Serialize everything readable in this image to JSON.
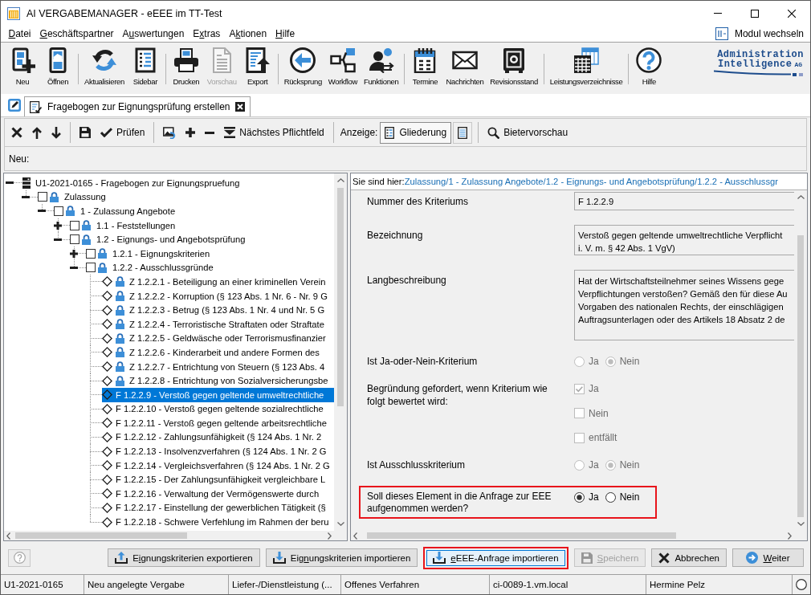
{
  "window": {
    "title": "AI VERGABEMANAGER - eEEE im TT-Test"
  },
  "menu": {
    "items": [
      {
        "access_key": "D",
        "text_after": "atei"
      },
      {
        "access_key": "G",
        "text_after": "eschäftspartner"
      },
      {
        "text_before": "A",
        "access_key": "u",
        "text_after": "swertungen"
      },
      {
        "text_before": "E",
        "access_key": "x",
        "text_after": "tras"
      },
      {
        "text_before": "A",
        "access_key": "k",
        "text_after": "tionen"
      },
      {
        "access_key": "H",
        "text_after": "ilfe"
      }
    ],
    "module_switch": "Modul wechseln"
  },
  "toolbar": {
    "groups": [
      [
        {
          "label": "Neu",
          "disabled": false
        },
        {
          "label": "Öffnen",
          "disabled": false
        }
      ],
      [
        {
          "label": "Aktualisieren",
          "disabled": false
        },
        {
          "label": "Sidebar",
          "disabled": false
        }
      ],
      [
        {
          "label": "Drucken",
          "disabled": false
        },
        {
          "label": "Vorschau",
          "disabled": true
        },
        {
          "label": "Export",
          "disabled": false
        }
      ],
      [
        {
          "label": "Rücksprung",
          "disabled": false
        },
        {
          "label": "Workflow",
          "disabled": false
        },
        {
          "label": "Funktionen",
          "disabled": false
        }
      ],
      [
        {
          "label": "Termine",
          "disabled": false
        },
        {
          "label": "Nachrichten",
          "disabled": false
        },
        {
          "label": "Revisionsstand",
          "disabled": false
        }
      ],
      [
        {
          "label": "Leistungsverzeichnisse",
          "disabled": false
        }
      ],
      [
        {
          "label": "Hilfe",
          "disabled": false
        }
      ]
    ],
    "logo": {
      "lines": [
        "Administration",
        "Intelligence"
      ],
      "suffix": "AG"
    }
  },
  "tabs": [
    {
      "label": "Fragebogen zur Eignungsprüfung erstellen",
      "selected": true
    }
  ],
  "editor_toolbar": {
    "groups": [
      [
        {
          "kind": "button"
        },
        {
          "kind": "button"
        },
        {
          "kind": "button"
        }
      ],
      [
        {
          "kind": "button"
        },
        {
          "kind": "button",
          "label": "Prüfen"
        }
      ],
      [
        {
          "kind": "button"
        },
        {
          "kind": "button"
        },
        {
          "kind": "button"
        },
        {
          "kind": "button",
          "label": "Nächstes Pflichtfeld"
        }
      ],
      [
        {
          "kind": "caption",
          "label": "Anzeige:"
        },
        {
          "kind": "toggle",
          "label": "Gliederung",
          "selected": true
        },
        {
          "kind": "toggle",
          "selected": false
        }
      ],
      [
        {
          "kind": "button",
          "label": "Bietervorschau"
        }
      ]
    ]
  },
  "info_bar": {
    "label": "Neu:"
  },
  "tree": [
    {
      "kind": "root",
      "label": "U1-2021-0165 - Fragebogen zur Eignungspruefung",
      "expanded": true,
      "selected": false,
      "children": [
        {
          "kind": "group",
          "label": "Zulassung",
          "checked": false,
          "locked": true,
          "expanded": true,
          "selected": false,
          "children": [
            {
              "kind": "group",
              "label": "1 - Zulassung Angebote",
              "checked": false,
              "locked": true,
              "expanded": true,
              "selected": false,
              "children": [
                {
                  "kind": "group",
                  "label": "1.1 - Feststellungen",
                  "checked": false,
                  "locked": true,
                  "expanded": false,
                  "selected": false
                },
                {
                  "kind": "group",
                  "label": "1.2 - Eignungs- und Angebotsprüfung",
                  "checked": false,
                  "locked": true,
                  "expanded": true,
                  "selected": false,
                  "children": [
                    {
                      "kind": "group",
                      "label": "1.2.1 - Eignungskriterien",
                      "checked": false,
                      "locked": true,
                      "expanded": false,
                      "selected": false
                    },
                    {
                      "kind": "group",
                      "label": "1.2.2 - Ausschlussgründe",
                      "checked": false,
                      "locked": true,
                      "expanded": true,
                      "selected": false,
                      "children": [
                        {
                          "kind": "criterion",
                          "label": "Z 1.2.2.1 - Beteiligung an einer kriminellen Verein",
                          "locked": true,
                          "selected": false
                        },
                        {
                          "kind": "criterion",
                          "label": "Z 1.2.2.2 - Korruption (§ 123 Abs. 1 Nr. 6 - Nr. 9 G",
                          "locked": true,
                          "selected": false
                        },
                        {
                          "kind": "criterion",
                          "label": "Z 1.2.2.3 - Betrug (§ 123 Abs. 1 Nr. 4 und Nr. 5 G",
                          "locked": true,
                          "selected": false
                        },
                        {
                          "kind": "criterion",
                          "label": "Z 1.2.2.4 - Terroristische Straftaten oder Straftate",
                          "locked": true,
                          "selected": false
                        },
                        {
                          "kind": "criterion",
                          "label": "Z 1.2.2.5 - Geldwäsche oder Terrorismusfinanzier",
                          "locked": true,
                          "selected": false
                        },
                        {
                          "kind": "criterion",
                          "label": "Z 1.2.2.6 - Kinderarbeit und andere Formen des",
                          "locked": true,
                          "selected": false
                        },
                        {
                          "kind": "criterion",
                          "label": "Z 1.2.2.7 - Entrichtung von Steuern (§ 123 Abs. 4",
                          "locked": true,
                          "selected": false
                        },
                        {
                          "kind": "criterion",
                          "label": "Z 1.2.2.8 - Entrichtung von Sozialversicherungsbe",
                          "locked": true,
                          "selected": false
                        },
                        {
                          "kind": "criterion",
                          "label": "F 1.2.2.9 - Verstoß gegen geltende umweltrechtliche",
                          "locked": false,
                          "selected": true
                        },
                        {
                          "kind": "criterion",
                          "label": "F 1.2.2.10 - Verstoß gegen geltende sozialrechtliche",
                          "locked": false,
                          "selected": false
                        },
                        {
                          "kind": "criterion",
                          "label": "F 1.2.2.11 - Verstoß gegen geltende arbeitsrechtliche",
                          "locked": false,
                          "selected": false
                        },
                        {
                          "kind": "criterion",
                          "label": "F 1.2.2.12 - Zahlungsunfähigkeit (§ 124 Abs. 1 Nr. 2",
                          "locked": false,
                          "selected": false
                        },
                        {
                          "kind": "criterion",
                          "label": "F 1.2.2.13 - Insolvenzverfahren (§ 124 Abs. 1 Nr. 2 G",
                          "locked": false,
                          "selected": false
                        },
                        {
                          "kind": "criterion",
                          "label": "F 1.2.2.14 - Vergleichsverfahren (§ 124 Abs. 1 Nr. 2 G",
                          "locked": false,
                          "selected": false
                        },
                        {
                          "kind": "criterion",
                          "label": "F 1.2.2.15 - Der Zahlungsunfähigkeit vergleichbare L",
                          "locked": false,
                          "selected": false
                        },
                        {
                          "kind": "criterion",
                          "label": "F 1.2.2.16 - Verwaltung der Vermögenswerte durch",
                          "locked": false,
                          "selected": false
                        },
                        {
                          "kind": "criterion",
                          "label": "F 1.2.2.17 - Einstellung der gewerblichen Tätigkeit (§",
                          "locked": false,
                          "selected": false
                        },
                        {
                          "kind": "criterion",
                          "label": "F 1.2.2.18 - Schwere Verfehlung im Rahmen der beru",
                          "locked": false,
                          "selected": false
                        }
                      ]
                    }
                  ]
                }
              ]
            }
          ]
        }
      ]
    }
  ],
  "breadcrumb": {
    "prefix": "Sie sind hier:",
    "items": [
      {
        "label": "Zulassung",
        "separator": "/"
      },
      {
        "label": "1 - Zulassung Angebote",
        "separator": "/"
      },
      {
        "label": "1.2 - Eignungs- und Angebotsprüfung",
        "separator": "/"
      },
      {
        "label": "1.2.2 - Ausschlussgr"
      }
    ]
  },
  "form": {
    "rows": [
      {
        "kind": "text",
        "label": "Nummer des Kriteriums",
        "value": "F 1.2.2.9",
        "highlighted": false
      },
      {
        "kind": "textarea",
        "label": "Bezeichnung",
        "lines": [
          "Verstoß gegen geltende umweltrechtliche Verpflicht",
          "i. V. m. § 42 Abs. 1 VgV)"
        ],
        "highlighted": false
      },
      {
        "kind": "longtext",
        "label": "Langbeschreibung",
        "lines": [
          "Hat der Wirtschaftsteilnehmer seines Wissens gege",
          "Verpflichtungen verstoßen? Gemäß den für diese Au",
          "Vorgaben des nationalen Rechts, der einschlägigen",
          "Auftragsunterlagen oder des Artikels 18 Absatz 2 de"
        ],
        "highlighted": false
      },
      {
        "kind": "radio",
        "label": "Ist Ja-oder-Nein-Kriterium",
        "disabled": true,
        "highlighted": false,
        "options": [
          {
            "label": "Ja",
            "selected": false
          },
          {
            "label": "Nein",
            "selected": true
          }
        ]
      },
      {
        "kind": "checkboxes",
        "label": "Begründung gefordert, wenn Kriterium wie folgt bewertet wird:",
        "disabled": true,
        "highlighted": false,
        "options": [
          {
            "label": "Ja",
            "checked": true
          },
          {
            "label": "Nein",
            "checked": false
          },
          {
            "label": "entfällt",
            "checked": false
          }
        ]
      },
      {
        "kind": "radio",
        "label": "Ist Ausschlusskriterium",
        "disabled": true,
        "highlighted": false,
        "options": [
          {
            "label": "Ja",
            "selected": false
          },
          {
            "label": "Nein",
            "selected": true
          }
        ]
      },
      {
        "kind": "radio",
        "label": "Soll dieses Element in die Anfrage zur EEE aufgenommen werden?",
        "disabled": false,
        "highlighted": true,
        "options": [
          {
            "label": "Ja",
            "selected": true
          },
          {
            "label": "Nein",
            "selected": false
          }
        ]
      }
    ]
  },
  "buttons": [
    {
      "kind": "help",
      "disabled": true
    },
    {
      "kind": "text",
      "text_before": "E",
      "access_key": "i",
      "text_after": "gnungskriterien exportieren",
      "disabled": false,
      "focused": false,
      "highlighted": false
    },
    {
      "kind": "text",
      "text_before": "Eig",
      "access_key": "n",
      "text_after": "ungskriterien importieren",
      "disabled": false,
      "focused": false,
      "highlighted": false
    },
    {
      "kind": "text",
      "access_key": "e",
      "text_after": "EEE-Anfrage importieren",
      "disabled": false,
      "focused": true,
      "highlighted": true
    },
    {
      "kind": "text",
      "access_key": "S",
      "text_after": "peichern",
      "disabled": true,
      "focused": false,
      "highlighted": false
    },
    {
      "kind": "text",
      "label": "Abbrechen",
      "disabled": false,
      "focused": false,
      "highlighted": false
    },
    {
      "kind": "text",
      "access_key": "W",
      "text_after": "eiter",
      "disabled": false,
      "focused": false,
      "highlighted": false
    }
  ],
  "status_bar": {
    "cells": [
      "U1-2021-0165",
      "Neu angelegte Vergabe",
      "Liefer-/Dienstleistung (...",
      "Offenes Verfahren",
      "ci-0089-1.vm.local",
      "Hermine Pelz"
    ]
  }
}
